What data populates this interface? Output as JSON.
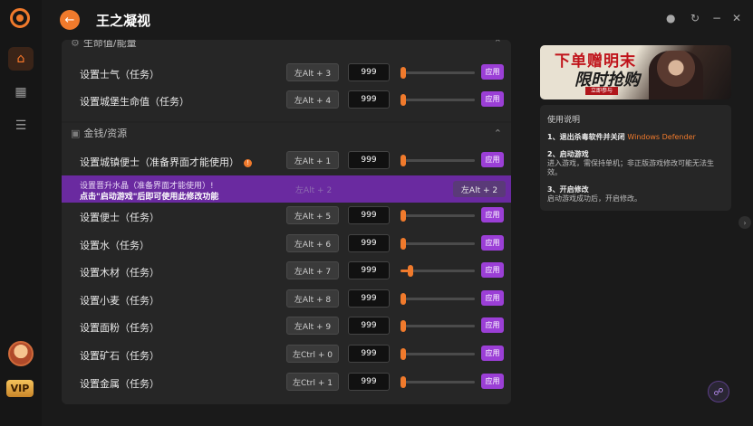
{
  "app": {
    "title": "王之凝视"
  },
  "rail": {
    "vip_label": "VIP"
  },
  "sections": {
    "top_partial_title": "生命值/能量",
    "money_title": "金钱/资源"
  },
  "rows_top": [
    {
      "label": "设置士气（任务）",
      "hotkey": "左Alt + 3",
      "value": "999",
      "apply": "应用",
      "level": 0.0
    },
    {
      "label": "设置城堡生命值（任务）",
      "hotkey": "左Alt + 4",
      "value": "999",
      "apply": "应用",
      "level": 0.0
    }
  ],
  "rows_money": [
    {
      "label": "设置城镇便士（准备界面才能使用）",
      "hotkey": "左Alt + 1",
      "value": "999",
      "apply": "应用",
      "level": 0.0,
      "warn": "!"
    },
    {
      "label": "设置便士（任务）",
      "hotkey": "左Alt + 5",
      "value": "999",
      "apply": "应用",
      "level": 0.0
    },
    {
      "label": "设置水（任务）",
      "hotkey": "左Alt + 6",
      "value": "999",
      "apply": "应用",
      "level": 0.0
    },
    {
      "label": "设置木材（任务）",
      "hotkey": "左Alt + 7",
      "value": "999",
      "apply": "应用",
      "level": 0.1
    },
    {
      "label": "设置小麦（任务）",
      "hotkey": "左Alt + 8",
      "value": "999",
      "apply": "应用",
      "level": 0.0
    },
    {
      "label": "设置面粉（任务）",
      "hotkey": "左Alt + 9",
      "value": "999",
      "apply": "应用",
      "level": 0.0
    },
    {
      "label": "设置矿石（任务）",
      "hotkey": "左Ctrl + 0",
      "value": "999",
      "apply": "应用",
      "level": 0.0
    },
    {
      "label": "设置金属（任务）",
      "hotkey": "左Ctrl + 1",
      "value": "999",
      "apply": "应用",
      "level": 0.0
    }
  ],
  "highlight_row": {
    "line1": "设置晋升水晶（准备界面才能使用）",
    "line2": "点击\"启动游戏\"后即可使用此修改功能",
    "ghost_hotkey": "左Alt + 2",
    "hotkey": "左Alt + 2",
    "warn": "!"
  },
  "banner": {
    "title_line1": "下单赠明末",
    "title_line2": "限时抢购",
    "tag": "立即参与"
  },
  "info": {
    "heading": "使用说明",
    "step1_title": "1、退出杀毒软件并关闭 ",
    "step1_highlight": "Windows Defender",
    "step2_title": "2、启动游戏",
    "step2_text": "进入游戏，需保持单机；非正版游戏修改可能无法生效。",
    "step3_title": "3、开启修改",
    "step3_text": "启动游戏成功后，开启修改。"
  },
  "colors": {
    "accent": "#f07a2c",
    "apply": "#9b3fd6",
    "highlight": "#6a2aa0"
  },
  "icons": [
    "app-logo-icon",
    "home-icon",
    "gamepad-icon",
    "database-icon",
    "back-arrow-icon",
    "record-icon",
    "refresh-icon",
    "minimize-icon",
    "close-icon",
    "chevron-up-icon",
    "chevron-right-icon",
    "headset-icon"
  ]
}
